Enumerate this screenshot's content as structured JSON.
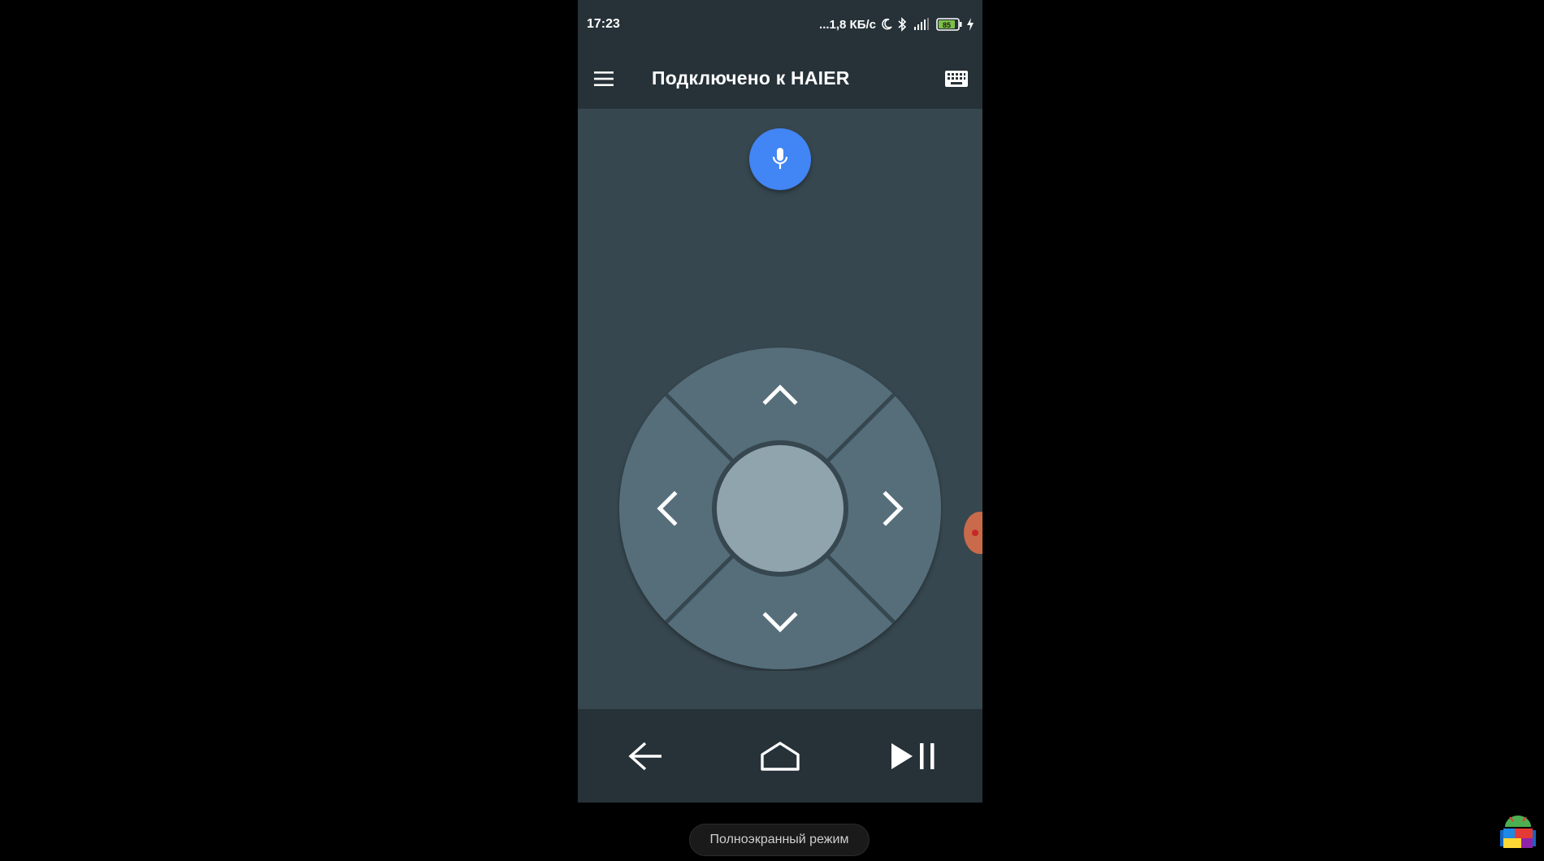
{
  "statusbar": {
    "time": "17:23",
    "network_speed": "...1,8 КБ/с",
    "battery_level": "85",
    "icons": [
      "moon-icon",
      "bluetooth-icon",
      "signal-icon",
      "battery-icon",
      "charging-icon"
    ]
  },
  "toolbar": {
    "title": "Подключено к HAIER",
    "menu_icon": "menu-icon",
    "keyboard_icon": "keyboard-icon"
  },
  "remote": {
    "mic_icon": "microphone-icon",
    "dpad": {
      "up_icon": "chevron-up-icon",
      "down_icon": "chevron-down-icon",
      "left_icon": "chevron-left-icon",
      "right_icon": "chevron-right-icon",
      "center": "ok-button"
    }
  },
  "bottom_nav": {
    "back_icon": "back-arrow-icon",
    "home_icon": "home-icon",
    "play_pause_icon": "play-pause-icon"
  },
  "overlay": {
    "fullscreen_label": "Полноэкранный режим"
  },
  "colors": {
    "page_bg": "#000000",
    "app_bg": "#37474f",
    "bar_bg": "#263238",
    "accent": "#4285f4",
    "dpad_ring": "#546e7a",
    "dpad_center": "#90a4ae"
  }
}
